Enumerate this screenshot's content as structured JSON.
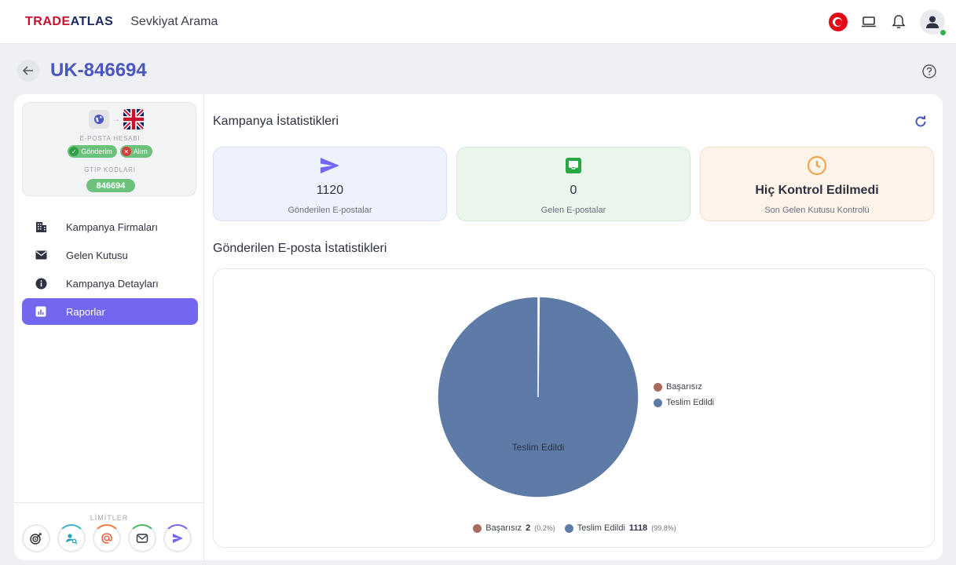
{
  "header": {
    "logo_red": "TRADE",
    "logo_blue": "ATLAS",
    "app_title": "Sevkiyat Arama"
  },
  "page": {
    "title": "UK-846694"
  },
  "account_card": {
    "email_caption": "E-POSTA HESABI",
    "send_chip": "Gönderim",
    "receive_chip": "Alım",
    "gtip_caption": "GTİP KODLARI",
    "gtip_code": "846694"
  },
  "nav": {
    "items": [
      {
        "label": "Kampanya Firmaları",
        "icon": "building-icon"
      },
      {
        "label": "Gelen Kutusu",
        "icon": "envelope-icon"
      },
      {
        "label": "Kampanya Detayları",
        "icon": "info-icon"
      },
      {
        "label": "Raporlar",
        "icon": "report-icon",
        "active": true
      }
    ]
  },
  "limits": {
    "title": "LİMİTLER"
  },
  "stats": {
    "title": "Kampanya İstatistikleri",
    "cards": [
      {
        "value": "1120",
        "label": "Gönderilen E-postalar",
        "icon": "send-icon"
      },
      {
        "value": "0",
        "label": "Gelen E-postalar",
        "icon": "inbox-icon"
      },
      {
        "value": "Hiç Kontrol Edilmedi",
        "label": "Son Gelen Kutusu Kontrolü",
        "icon": "clock-icon"
      }
    ]
  },
  "email_stats": {
    "title": "Gönderilen E-posta İstatistikleri"
  },
  "chart_data": {
    "type": "pie",
    "categories": [
      "Başarısız",
      "Teslim Edildi"
    ],
    "values": [
      2,
      1118
    ],
    "percentages": [
      "0.2%",
      "99.8%"
    ],
    "colors": [
      "#a86b5f",
      "#5e7aa6"
    ],
    "slice_label": "Teslim Edildi",
    "legend_placement": "right",
    "bottom_legend": [
      {
        "name": "Başarısız",
        "value": "2",
        "pct": "(0.2%)"
      },
      {
        "name": "Teslim Edildi",
        "value": "1118",
        "pct": "(99.8%)"
      }
    ]
  },
  "colors": {
    "accent": "#7367f0",
    "title": "#4a56c2",
    "success": "#6cc27a"
  }
}
